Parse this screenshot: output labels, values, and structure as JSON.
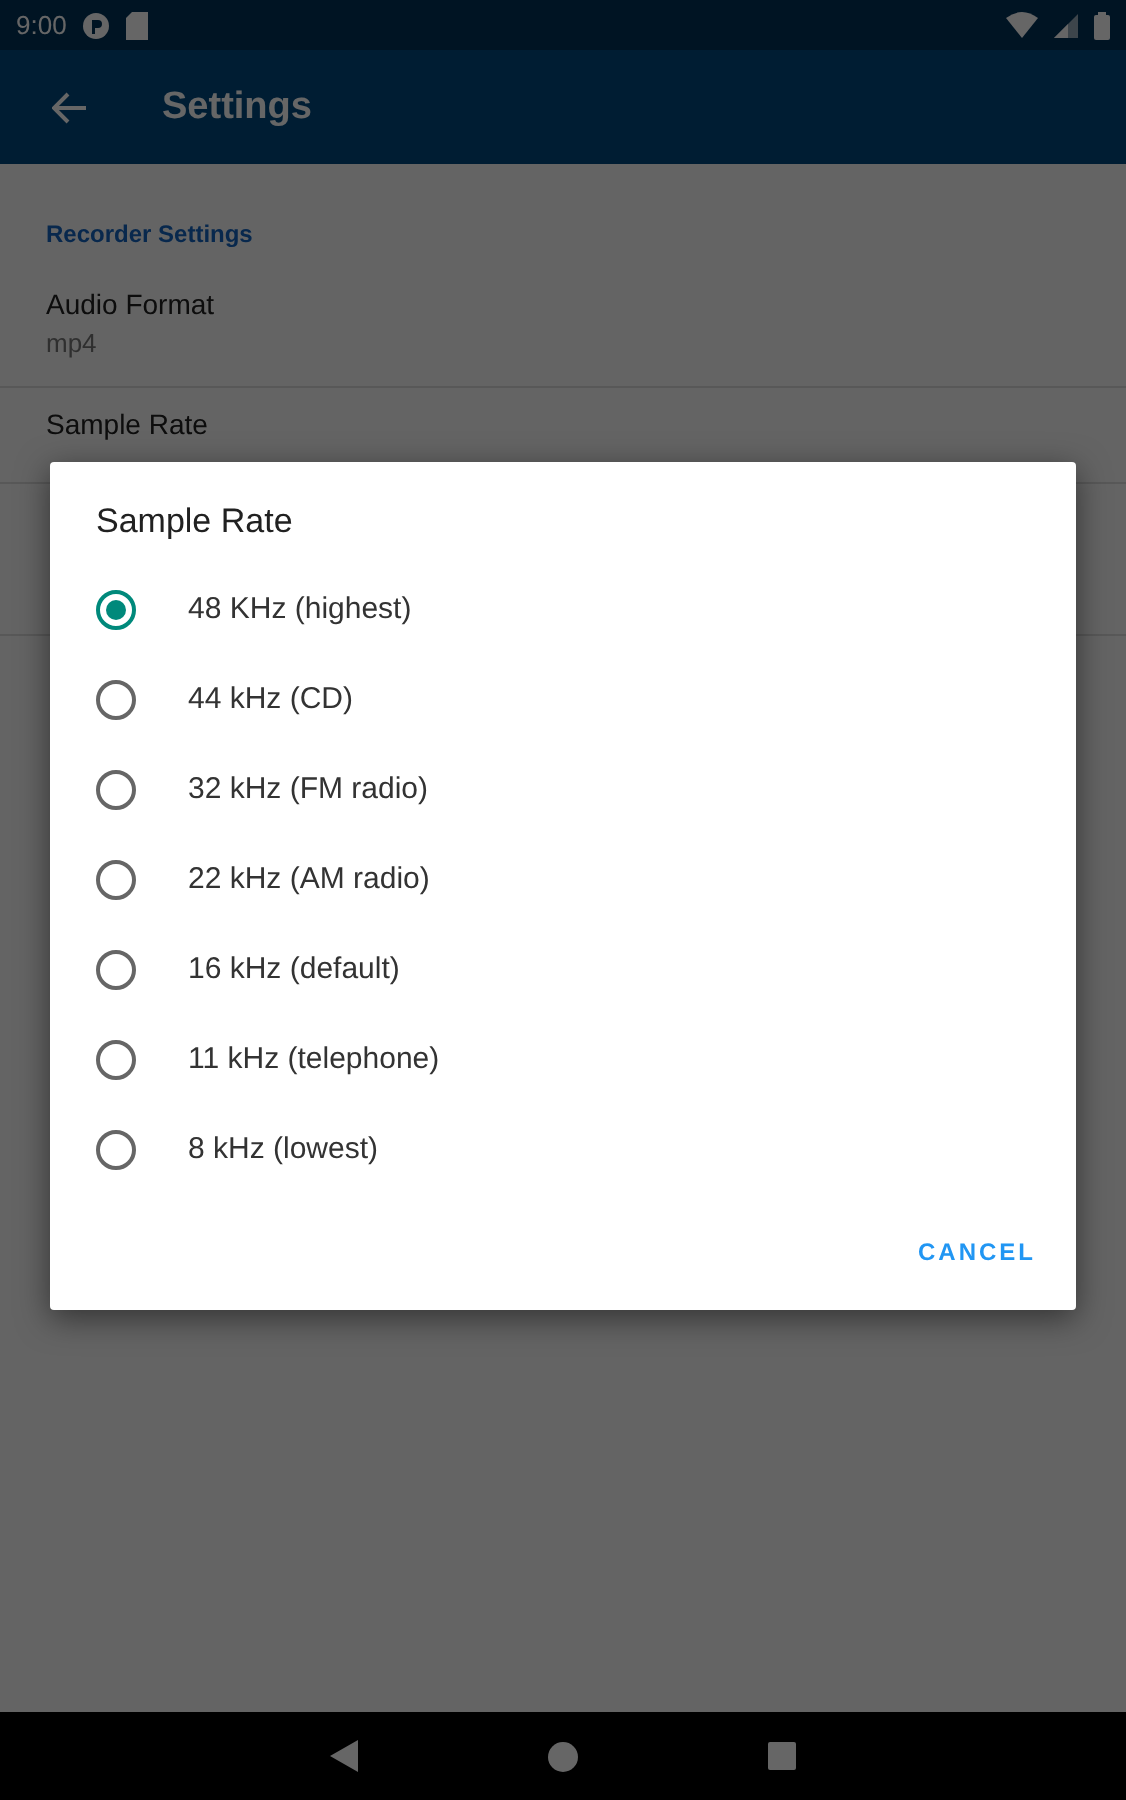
{
  "status_bar": {
    "time": "9:00"
  },
  "app_bar": {
    "title": "Settings"
  },
  "settings": {
    "section": "Recorder Settings",
    "items": [
      {
        "title": "Audio Format",
        "value": "mp4"
      },
      {
        "title": "Sample Rate"
      }
    ]
  },
  "dialog": {
    "title": "Sample Rate",
    "options": [
      {
        "label": "48 KHz (highest)",
        "selected": true
      },
      {
        "label": "44 kHz (CD)",
        "selected": false
      },
      {
        "label": "32 kHz (FM radio)",
        "selected": false
      },
      {
        "label": "22 kHz (AM radio)",
        "selected": false
      },
      {
        "label": "16 kHz (default)",
        "selected": false
      },
      {
        "label": "11 kHz (telephone)",
        "selected": false
      },
      {
        "label": "8 kHz (lowest)",
        "selected": false
      }
    ],
    "buttons": [
      "CANCEL"
    ]
  }
}
